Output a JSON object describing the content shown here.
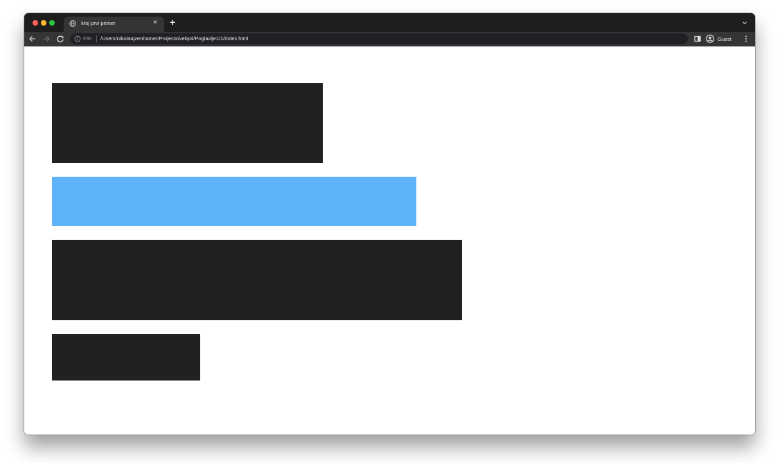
{
  "browser": {
    "tab_title": "Moj prvi primer",
    "tab_close": "×",
    "new_tab": "+",
    "address": {
      "scheme_label": "File",
      "url": "/Users/nikolaajzenhamer/Projects/vebp4/Poglavlje1/1/index.html"
    },
    "profile_label": "Guest",
    "icons": {
      "traffic_close": "close-window-icon",
      "traffic_minimize": "minimize-window-icon",
      "traffic_zoom": "zoom-window-icon",
      "tab_favicon": "globe-icon",
      "tab_search": "chevron-down-icon",
      "back": "arrow-left-icon",
      "forward": "arrow-right-icon",
      "reload": "reload-icon",
      "site_info": "info-icon",
      "side_panel": "side-panel-icon",
      "profile": "profile-icon",
      "menu": "kebab-menu-icon"
    }
  },
  "colors": {
    "traffic_close": "#ff5f57",
    "traffic_minimize": "#febc2e",
    "traffic_zoom": "#28c840",
    "dark_block": "#212123",
    "blue_block": "#5eb3f8"
  },
  "page": {
    "blocks": [
      {
        "color": "dark"
      },
      {
        "color": "blue"
      },
      {
        "color": "dark"
      },
      {
        "color": "dark"
      }
    ]
  }
}
